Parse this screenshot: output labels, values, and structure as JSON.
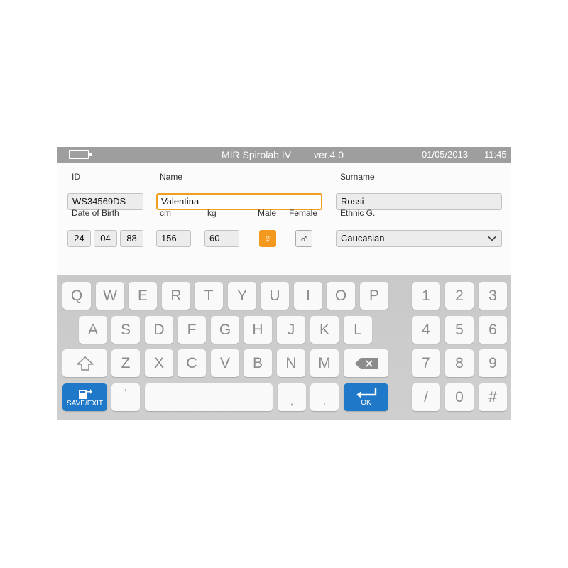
{
  "statusbar": {
    "app_title": "MIR Spirolab IV",
    "version": "ver.4.0",
    "date": "01/05/2013",
    "time": "11:45",
    "battery_icon": "battery-icon"
  },
  "form": {
    "id_label": "ID",
    "id_value": "WS34569DS",
    "name_label": "Name",
    "name_value": "Valentina",
    "surname_label": "Surname",
    "surname_value": "Rossi",
    "dob_label": "Date of Birth",
    "dob_day": "24",
    "dob_month": "04",
    "dob_year": "88",
    "height_label": "cm",
    "height_value": "156",
    "weight_label": "kg",
    "weight_value": "60",
    "male_label": "Male",
    "female_label": "Female",
    "male_symbol": "♀",
    "female_symbol": "♂",
    "ethnic_label": "Ethnic G.",
    "ethnic_value": "Caucasian"
  },
  "keyboard": {
    "row1": [
      "Q",
      "W",
      "E",
      "R",
      "T",
      "Y",
      "U",
      "I",
      "O",
      "P"
    ],
    "row2": [
      "A",
      "S",
      "D",
      "F",
      "G",
      "H",
      "J",
      "K",
      "L"
    ],
    "row3": [
      "Z",
      "X",
      "C",
      "V",
      "B",
      "N",
      "M"
    ],
    "numpad": [
      "1",
      "2",
      "3",
      "4",
      "5",
      "6",
      "7",
      "8",
      "9",
      "/",
      "0",
      "#"
    ],
    "apostrophe": "‘",
    "comma": ",",
    "period": ".",
    "save_exit": "SAVE/EXIT",
    "ok": "OK"
  },
  "colors": {
    "accent": "#f39a1e",
    "action": "#1f78c8",
    "statusbar": "#9e9e9e"
  }
}
